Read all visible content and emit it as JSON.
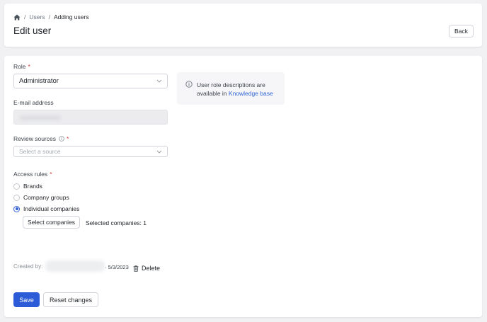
{
  "breadcrumb": {
    "items": [
      "Users",
      "Adding users"
    ],
    "separator": "/"
  },
  "header": {
    "title": "Edit user",
    "back_label": "Back"
  },
  "form": {
    "role": {
      "label": "Role",
      "required_mark": "*",
      "value": "Administrator"
    },
    "email": {
      "label": "E-mail address"
    },
    "sources": {
      "label": "Review sources",
      "required_mark": "*",
      "placeholder": "Select a source"
    },
    "access": {
      "label": "Access rules",
      "required_mark": "*",
      "options": [
        {
          "label": "Brands",
          "checked": false
        },
        {
          "label": "Company groups",
          "checked": false
        },
        {
          "label": "Individual companies",
          "checked": true
        }
      ],
      "select_companies_label": "Select companies",
      "selected_text": "Selected companies: 1"
    },
    "info": {
      "text": "User role descriptions are available in",
      "link": "Knowledge base"
    },
    "meta": {
      "created_label": "Created by:",
      "date": "· 5/3/2023",
      "delete_label": "Delete"
    },
    "actions": {
      "save_label": "Save",
      "reset_label": "Reset changes"
    }
  },
  "colors": {
    "primary": "#2b5bd7",
    "required": "#d63a3a",
    "link": "#2f64d6"
  }
}
